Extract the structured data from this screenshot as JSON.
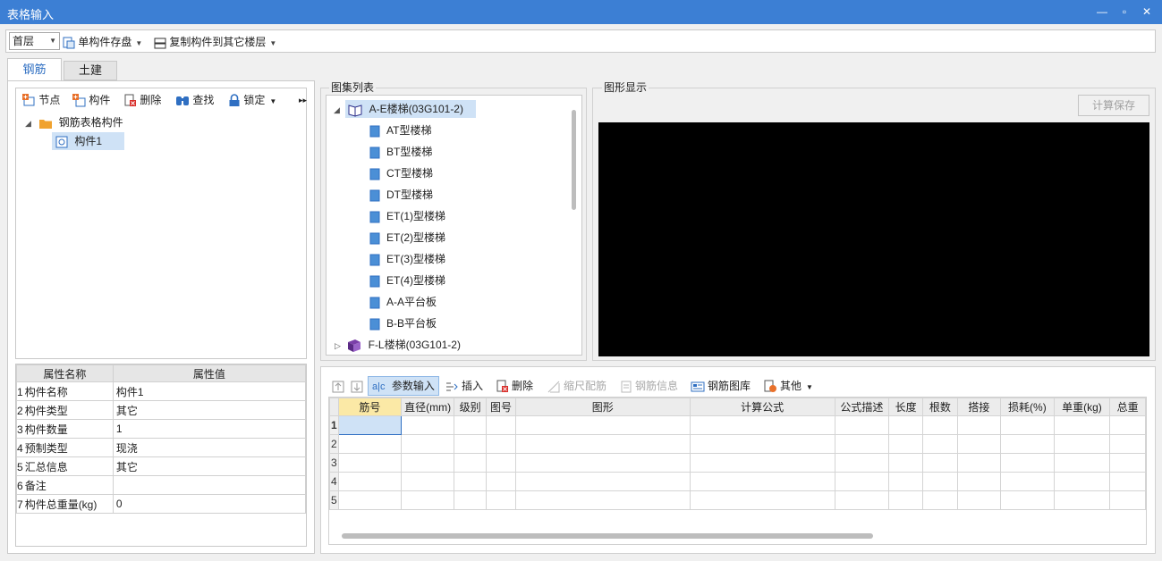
{
  "window": {
    "title": "表格输入"
  },
  "toolbar": {
    "floor": "首层",
    "save_single": "单构件存盘",
    "copy_to_floors": "复制构件到其它楼层"
  },
  "tabs": [
    {
      "label": "钢筋"
    },
    {
      "label": "土建"
    }
  ],
  "left_toolbar": {
    "node": "节点",
    "component": "构件",
    "delete": "删除",
    "find": "查找",
    "lock": "锁定",
    "more": "▸▸"
  },
  "tree": {
    "root": "钢筋表格构件",
    "child": "构件1"
  },
  "properties": {
    "headers": [
      "属性名称",
      "属性值"
    ],
    "rows": [
      {
        "no": "1",
        "name": "构件名称",
        "value": "构件1"
      },
      {
        "no": "2",
        "name": "构件类型",
        "value": "其它"
      },
      {
        "no": "3",
        "name": "构件数量",
        "value": "1"
      },
      {
        "no": "4",
        "name": "预制类型",
        "value": "现浇"
      },
      {
        "no": "5",
        "name": "汇总信息",
        "value": "其它"
      },
      {
        "no": "6",
        "name": "备注",
        "value": ""
      },
      {
        "no": "7",
        "name": "构件总重量(kg)",
        "value": "0"
      }
    ]
  },
  "atlas": {
    "label": "图集列表",
    "group1": "A-E楼梯(03G101-2)",
    "items": [
      "AT型楼梯",
      "BT型楼梯",
      "CT型楼梯",
      "DT型楼梯",
      "ET(1)型楼梯",
      "ET(2)型楼梯",
      "ET(3)型楼梯",
      "ET(4)型楼梯",
      "A-A平台板",
      "B-B平台板"
    ],
    "group2": "F-L楼梯(03G101-2)"
  },
  "graphic": {
    "label": "图形显示",
    "calc_save": "计算保存"
  },
  "bottom_toolbar": {
    "param_input": "参数输入",
    "insert": "插入",
    "delete": "删除",
    "scale_rebar": "缩尺配筋",
    "rebar_info": "钢筋信息",
    "rebar_library": "钢筋图库",
    "other": "其他"
  },
  "rebar_grid": {
    "headers": [
      "筋号",
      "直径(mm)",
      "级别",
      "图号",
      "图形",
      "计算公式",
      "公式描述",
      "长度",
      "根数",
      "搭接",
      "损耗(%)",
      "单重(kg)",
      "总重"
    ],
    "row_numbers": [
      "1",
      "2",
      "3",
      "4",
      "5"
    ]
  },
  "colors": {
    "titlebar": "#3c7fd4",
    "accent": "#2f6fc2",
    "selection": "#cfe2f6",
    "canvas": "#000000"
  }
}
